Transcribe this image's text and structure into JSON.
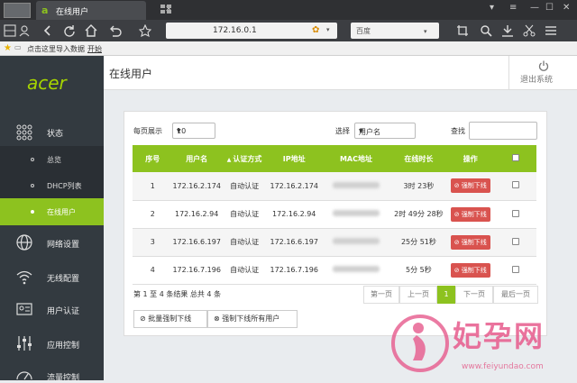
{
  "browser": {
    "tab_title": "在线用户",
    "address": "172.16.0.1",
    "search_placeholder": "百度",
    "bookmark_import": "点击这里导入数据",
    "bookmark_start": "开始"
  },
  "sidebar": {
    "logo": "acer",
    "items": [
      {
        "label": "状态",
        "icon": "grid-dots-icon"
      },
      {
        "label": "网络设置",
        "icon": "globe-icon"
      },
      {
        "label": "无线配置",
        "icon": "wifi-icon"
      },
      {
        "label": "用户认证",
        "icon": "id-card-icon"
      },
      {
        "label": "应用控制",
        "icon": "sliders-icon"
      },
      {
        "label": "流量控制",
        "icon": "gauge-icon"
      }
    ],
    "subitems": [
      {
        "label": "总览"
      },
      {
        "label": "DHCP列表"
      },
      {
        "label": "在线用户"
      }
    ]
  },
  "header": {
    "title": "在线用户",
    "logout": "退出系统"
  },
  "controls": {
    "per_page_label": "每页展示",
    "per_page_value": "10",
    "select_label": "选择",
    "select_value": "用户名",
    "search_label": "查找"
  },
  "table": {
    "headers": [
      "序号",
      "用户名",
      "认证方式",
      "IP地址",
      "MAC地址",
      "在线时长",
      "操作"
    ],
    "rows": [
      {
        "no": "1",
        "user": "172.16.2.174",
        "auth": "自动认证",
        "ip": "172.16.2.174",
        "duration": "3时 23秒",
        "action": "强制下线"
      },
      {
        "no": "2",
        "user": "172.16.2.94",
        "auth": "自动认证",
        "ip": "172.16.2.94",
        "duration": "2时 49分 28秒",
        "action": "强制下线"
      },
      {
        "no": "3",
        "user": "172.16.6.197",
        "auth": "自动认证",
        "ip": "172.16.6.197",
        "duration": "25分 51秒",
        "action": "强制下线"
      },
      {
        "no": "4",
        "user": "172.16.7.196",
        "auth": "自动认证",
        "ip": "172.16.7.196",
        "duration": "5分 5秒",
        "action": "强制下线"
      }
    ]
  },
  "footer": {
    "summary": "第 1 至 4 条结果  总共 4 条",
    "pager": [
      "第一页",
      "上一页",
      "1",
      "下一页",
      "最后一页"
    ],
    "btn_batch": "批量强制下线",
    "btn_all": "强制下线所有用户"
  },
  "watermark": {
    "text": "妃孕网",
    "url": "www.feiyundao.com"
  },
  "colors": {
    "accent": "#8dc21f",
    "sidebar": "#333a40",
    "danger": "#d9534f"
  }
}
